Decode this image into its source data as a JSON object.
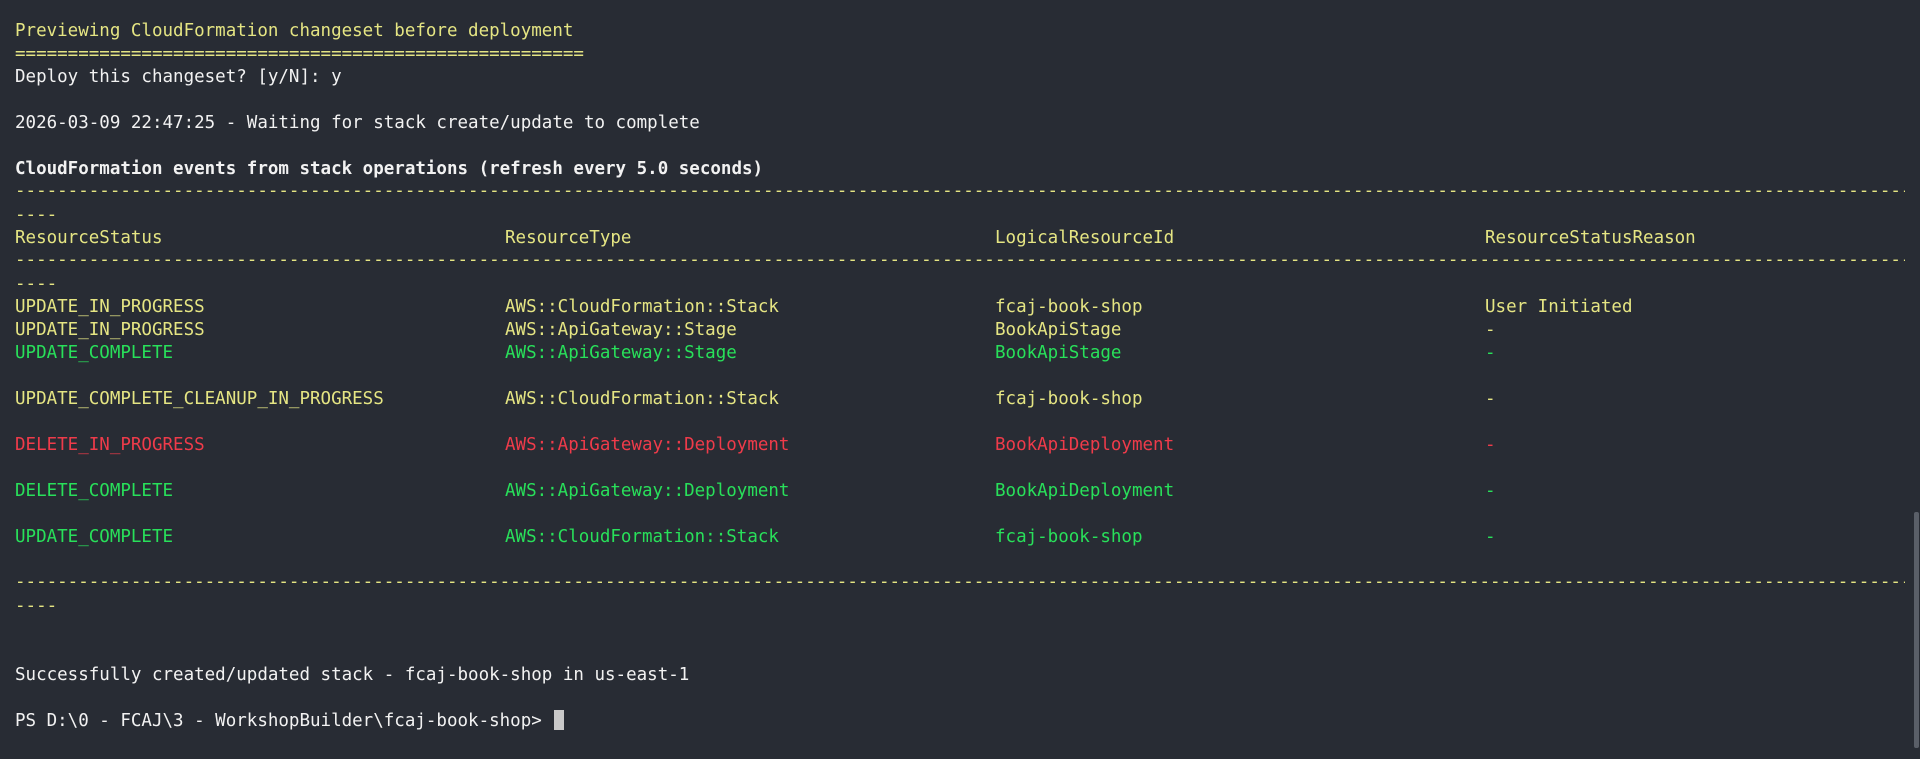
{
  "header": {
    "title": "Previewing CloudFormation changeset before deployment",
    "underline": "======================================================",
    "prompt": "Deploy this changeset? [y/N]: y",
    "waiting": "2026-03-09 22:47:25 - Waiting for stack create/update to complete",
    "events_title": "CloudFormation events from stack operations (refresh every 5.0 seconds)"
  },
  "rule": {
    "main": "-------------------------------------------------------------------------------------------------------------------------------------------------------------------------------------------------------------------",
    "tail": "----"
  },
  "table": {
    "headers": [
      "ResourceStatus",
      "ResourceType",
      "LogicalResourceId",
      "ResourceStatusReason"
    ],
    "rows": [
      {
        "status": "UPDATE_IN_PROGRESS",
        "type": "AWS::CloudFormation::Stack",
        "id": "fcaj-book-shop",
        "reason": "User Initiated",
        "color": "#e5e583"
      },
      {
        "status": "UPDATE_IN_PROGRESS",
        "type": "AWS::ApiGateway::Stage",
        "id": "BookApiStage",
        "reason": "-",
        "color": "#e5e583"
      },
      {
        "status": "UPDATE_COMPLETE",
        "type": "AWS::ApiGateway::Stage",
        "id": "BookApiStage",
        "reason": "-",
        "color": "#28e05a"
      },
      {
        "status": "UPDATE_COMPLETE_CLEANUP_IN_PROGRESS",
        "type": "AWS::CloudFormation::Stack",
        "id": "fcaj-book-shop",
        "reason": "-",
        "color": "#e5e583"
      },
      {
        "status": "DELETE_IN_PROGRESS",
        "type": "AWS::ApiGateway::Deployment",
        "id": "BookApiDeployment",
        "reason": "-",
        "color": "#ef3b4a"
      },
      {
        "status": "DELETE_COMPLETE",
        "type": "AWS::ApiGateway::Deployment",
        "id": "BookApiDeployment",
        "reason": "-",
        "color": "#28e05a"
      },
      {
        "status": "UPDATE_COMPLETE",
        "type": "AWS::CloudFormation::Stack",
        "id": "fcaj-book-shop",
        "reason": "-",
        "color": "#28e05a"
      }
    ]
  },
  "footer": {
    "success": "Successfully created/updated stack - fcaj-book-shop in us-east-1",
    "ps_prompt": "PS D:\\0 - FCAJ\\3 - WorkshopBuilder\\fcaj-book-shop>"
  },
  "colors": {
    "background": "#282c34",
    "yellow": "#e5e583",
    "green": "#28e05a",
    "red": "#ef3b4a",
    "white": "#f2f2f2"
  }
}
